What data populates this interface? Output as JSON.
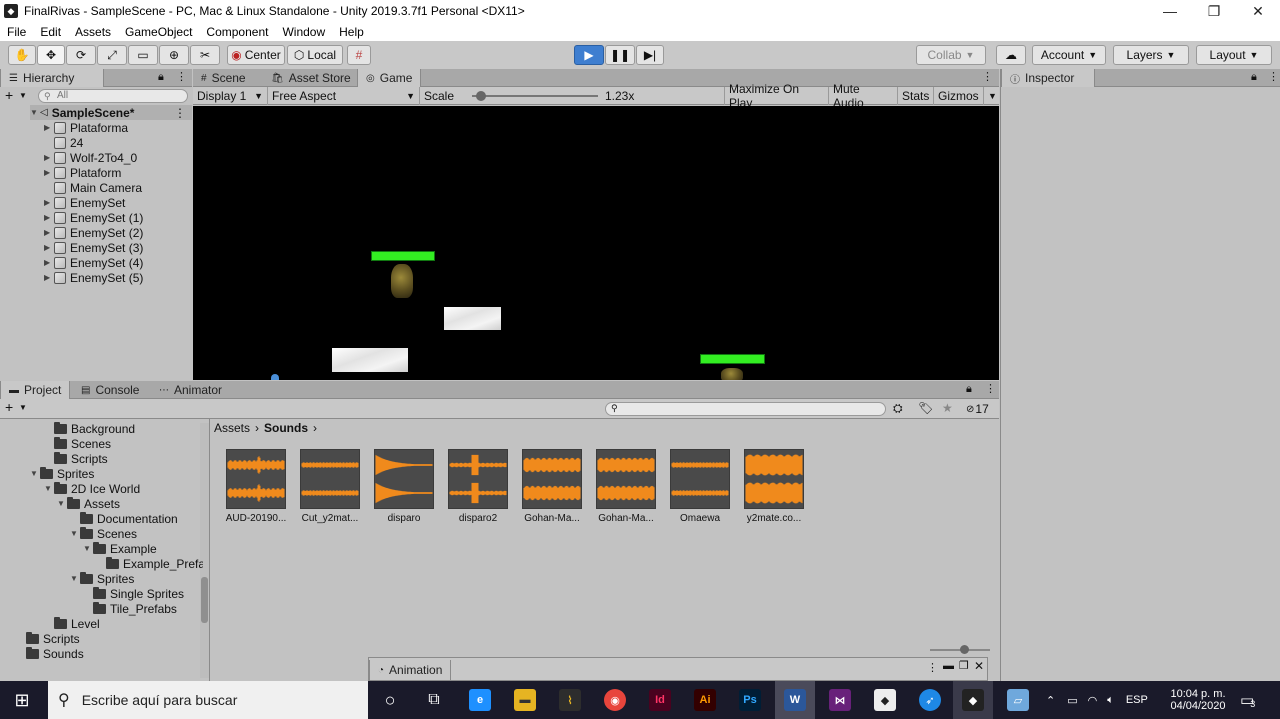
{
  "window": {
    "title": "FinalRivas - SampleScene - PC, Mac & Linux Standalone - Unity 2019.3.7f1 Personal <DX11>",
    "controls": [
      "—",
      "❐",
      "✕"
    ]
  },
  "menu": [
    "File",
    "Edit",
    "Assets",
    "GameObject",
    "Component",
    "Window",
    "Help"
  ],
  "toolbar": {
    "pivot": "Center",
    "space": "Local",
    "collab": "Collab",
    "account": "Account",
    "layers": "Layers",
    "layout": "Layout"
  },
  "hierarchy": {
    "tab": "Hierarchy",
    "search_placeholder": "All",
    "scene": "SampleScene*",
    "items": [
      {
        "label": "Plataforma",
        "expandable": true
      },
      {
        "label": "24",
        "expandable": false
      },
      {
        "label": "Wolf-2To4_0",
        "expandable": true
      },
      {
        "label": "Plataform",
        "expandable": true
      },
      {
        "label": "Main Camera",
        "expandable": false
      },
      {
        "label": "EnemySet",
        "expandable": true
      },
      {
        "label": "EnemySet (1)",
        "expandable": true
      },
      {
        "label": "EnemySet (2)",
        "expandable": true
      },
      {
        "label": "EnemySet (3)",
        "expandable": true
      },
      {
        "label": "EnemySet (4)",
        "expandable": true
      },
      {
        "label": "EnemySet (5)",
        "expandable": true
      }
    ]
  },
  "center_tabs": [
    "Scene",
    "Asset Store",
    "Game"
  ],
  "game": {
    "display": "Display 1",
    "aspect": "Free Aspect",
    "scale_label": "Scale",
    "scale_value": "1.23x",
    "maximize": "Maximize On Play",
    "mute": "Mute Audio",
    "stats": "Stats",
    "gizmos": "Gizmos"
  },
  "inspector": {
    "tab": "Inspector"
  },
  "bottom_tabs": [
    "Project",
    "Console",
    "Animator"
  ],
  "project": {
    "hidden_count": "17",
    "breadcrumb": [
      "Assets",
      "Sounds"
    ],
    "tree": [
      {
        "label": "Background",
        "indent": 0
      },
      {
        "label": "Scenes",
        "indent": 0
      },
      {
        "label": "Scripts",
        "indent": 0
      },
      {
        "label": "Sprites",
        "indent": -1,
        "open": true
      },
      {
        "label": "2D Ice World",
        "indent": 0,
        "open": true
      },
      {
        "label": "Assets",
        "indent": 1,
        "open": true
      },
      {
        "label": "Documentation",
        "indent": 2
      },
      {
        "label": "Scenes",
        "indent": 2,
        "open": true
      },
      {
        "label": "Example",
        "indent": 3,
        "open": true
      },
      {
        "label": "Example_Prefabs",
        "indent": 4
      },
      {
        "label": "Sprites",
        "indent": 2,
        "open": true
      },
      {
        "label": "Single Sprites",
        "indent": 3
      },
      {
        "label": "Tile_Prefabs",
        "indent": 3
      },
      {
        "label": "Level",
        "indent": 0
      },
      {
        "label": "Scripts",
        "indent": -2
      },
      {
        "label": "Sounds",
        "indent": -2
      }
    ],
    "assets": [
      {
        "label": "AUD-20190...",
        "wave": "spiky"
      },
      {
        "label": "Cut_y2mat...",
        "wave": "flat"
      },
      {
        "label": "disparo",
        "wave": "decay"
      },
      {
        "label": "disparo2",
        "wave": "burst"
      },
      {
        "label": "Gohan-Ma...",
        "wave": "dense"
      },
      {
        "label": "Gohan-Ma...",
        "wave": "dense"
      },
      {
        "label": "Omaewa",
        "wave": "flat"
      },
      {
        "label": "y2mate.co...",
        "wave": "full"
      }
    ]
  },
  "animation": {
    "tab": "Animation"
  },
  "taskbar": {
    "search_placeholder": "Escribe aquí para buscar",
    "lang": "ESP",
    "time": "10:04 p. m.",
    "date": "04/04/2020",
    "notifications": "3",
    "colors": {
      "edge": "#1e90ff",
      "chrome": "#e8453c",
      "indesign": "#49021f",
      "illustrator": "#330000",
      "photoshop": "#001e36",
      "word": "#2b579a",
      "vs": "#68217a"
    }
  }
}
